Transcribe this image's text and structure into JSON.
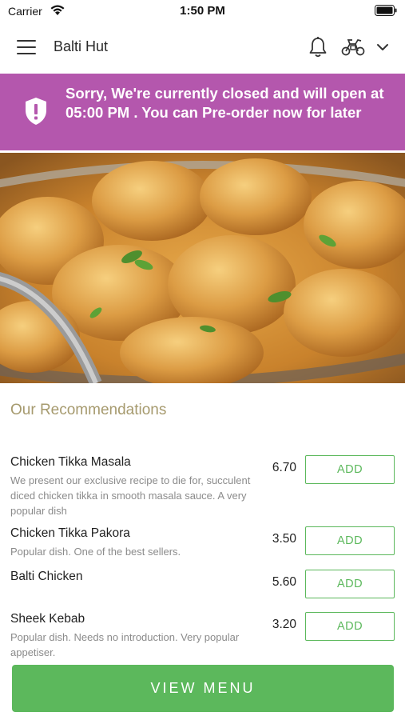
{
  "status_bar": {
    "carrier": "Carrier",
    "time": "1:50 PM"
  },
  "header": {
    "title": "Balti Hut",
    "icons": [
      "menu-icon",
      "bell-icon",
      "delivery-scooter-icon",
      "chevron-down-icon"
    ]
  },
  "banner": {
    "text": "Sorry, We're currently closed and will open at 05:00 PM . You can Pre-order now for later",
    "icon": "shield-alert-icon",
    "color": "#b457ad"
  },
  "recommendations": {
    "title": "Our Recommendations",
    "items": [
      {
        "name": "Chicken Tikka Masala",
        "description": "We present our exclusive recipe to die for, succulent diced chicken tikka in smooth masala sauce. A very popular dish",
        "price": "6.70",
        "button": "ADD"
      },
      {
        "name": "Chicken Tikka Pakora",
        "description": "Popular dish. One of the best sellers.",
        "price": "3.50",
        "button": "ADD"
      },
      {
        "name": "Balti Chicken",
        "description": "",
        "price": "5.60",
        "button": "ADD"
      },
      {
        "name": "Sheek Kebab",
        "description": "Popular dish. Needs no introduction. Very popular appetiser.",
        "price": "3.20",
        "button": "ADD"
      }
    ]
  },
  "footer": {
    "view_menu": "VIEW MENU"
  },
  "colors": {
    "accent_green": "#5cb85c",
    "banner_purple": "#b457ad",
    "section_title": "#a69a6e"
  }
}
